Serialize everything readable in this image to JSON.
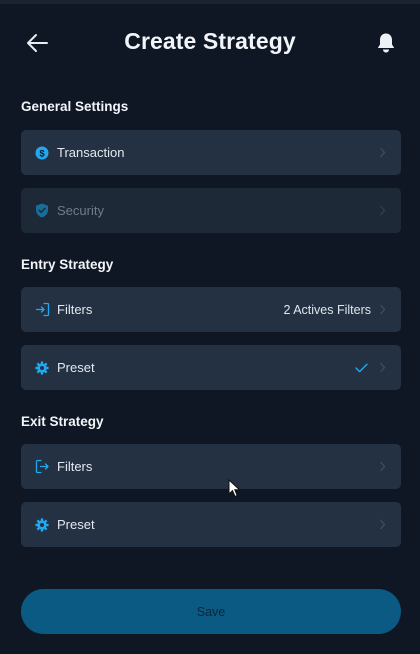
{
  "header": {
    "title": "Create Strategy",
    "back_icon": "arrow-left-icon",
    "notification_icon": "bell-icon"
  },
  "sections": {
    "general": {
      "title": "General Settings",
      "transaction": {
        "label": "Transaction",
        "icon": "dollar-coin-icon"
      },
      "security": {
        "label": "Security",
        "icon": "shield-check-icon",
        "disabled": true
      }
    },
    "entry": {
      "title": "Entry Strategy",
      "filters": {
        "label": "Filters",
        "value": "2 Actives Filters",
        "icon": "sign-in-icon"
      },
      "preset": {
        "label": "Preset",
        "icon": "gear-icon",
        "checked": true
      }
    },
    "exit": {
      "title": "Exit Strategy",
      "filters": {
        "label": "Filters",
        "icon": "sign-out-icon"
      },
      "preset": {
        "label": "Preset",
        "icon": "gear-icon"
      }
    }
  },
  "footer": {
    "save_label": "Save"
  },
  "colors": {
    "background": "#0f1724",
    "row": "#243142",
    "accent": "#23a8ef",
    "save_button": "#0a5a84"
  }
}
